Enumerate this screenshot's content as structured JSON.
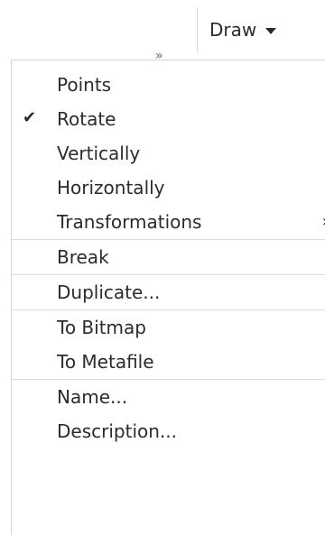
{
  "toolbar": {
    "overflow_glyph": "»",
    "draw_label": "Draw"
  },
  "menu": {
    "groups": [
      {
        "items": [
          {
            "label": "Points",
            "checked": false
          },
          {
            "label": "Rotate",
            "checked": true
          },
          {
            "label": "Vertically",
            "checked": false
          },
          {
            "label": "Horizontally",
            "checked": false
          },
          {
            "label": "Transformations",
            "has_submenu": true
          }
        ]
      },
      {
        "items": [
          {
            "label": "Break"
          }
        ]
      },
      {
        "items": [
          {
            "label": "Duplicate..."
          }
        ]
      },
      {
        "items": [
          {
            "label": "To Bitmap"
          },
          {
            "label": "To Metafile"
          }
        ]
      },
      {
        "items": [
          {
            "label": "Name..."
          },
          {
            "label": "Description..."
          }
        ]
      }
    ],
    "check_glyph": "✔",
    "submenu_glyph": "›"
  }
}
